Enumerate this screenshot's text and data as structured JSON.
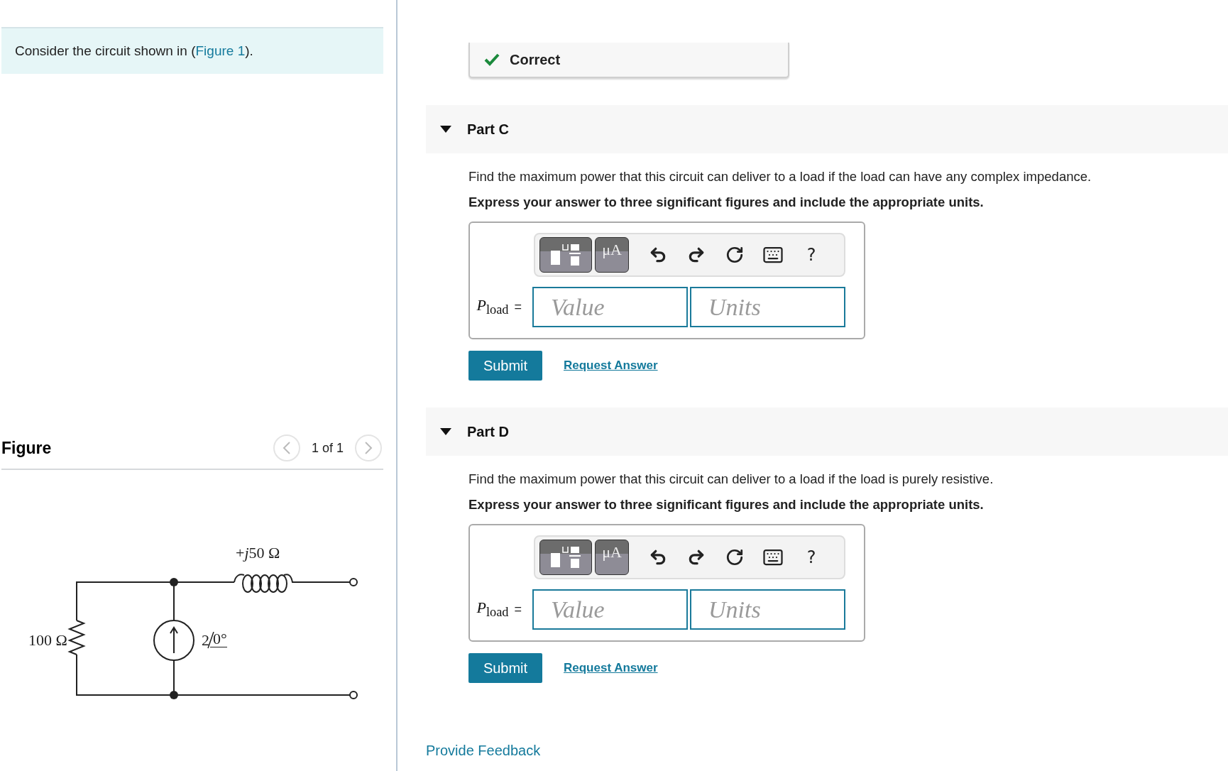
{
  "problem": {
    "text_before": "Consider the circuit shown in (",
    "link": "Figure 1",
    "text_after": ")."
  },
  "figure": {
    "title": "Figure",
    "pager": "1 of 1",
    "circuit": {
      "inductor_sign": "+",
      "inductor_imaginary": "j",
      "inductor_value": "50 Ω",
      "resistor": "100 Ω",
      "source_magnitude": "2",
      "source_angle": "0°"
    }
  },
  "feedback": {
    "status": "Correct"
  },
  "parts": [
    {
      "title": "Part C",
      "expanded": true,
      "question": "Find the maximum power that this circuit can deliver to a load if the load can have any complex impedance.",
      "instruction": "Express your answer to three significant figures and include the appropriate units.",
      "toolbar": {
        "units_button": "μA",
        "help": "?"
      },
      "answer": {
        "label": "*P*$_{load}$",
        "equals": "=",
        "value_placeholder": "Value",
        "units_placeholder": "Units"
      },
      "submit": "Submit",
      "request": "Request Answer"
    },
    {
      "title": "Part D",
      "expanded": true,
      "question": "Find the maximum power that this circuit can deliver to a load if the load is purely resistive.",
      "instruction": "Express your answer to three significant figures and include the appropriate units.",
      "toolbar": {
        "units_button": "μA",
        "help": "?"
      },
      "answer": {
        "label": "*P*$_{load}$",
        "equals": "=",
        "value_placeholder": "Value",
        "units_placeholder": "Units"
      },
      "submit": "Submit",
      "request": "Request Answer"
    }
  ],
  "footer_link": "Provide Feedback"
}
